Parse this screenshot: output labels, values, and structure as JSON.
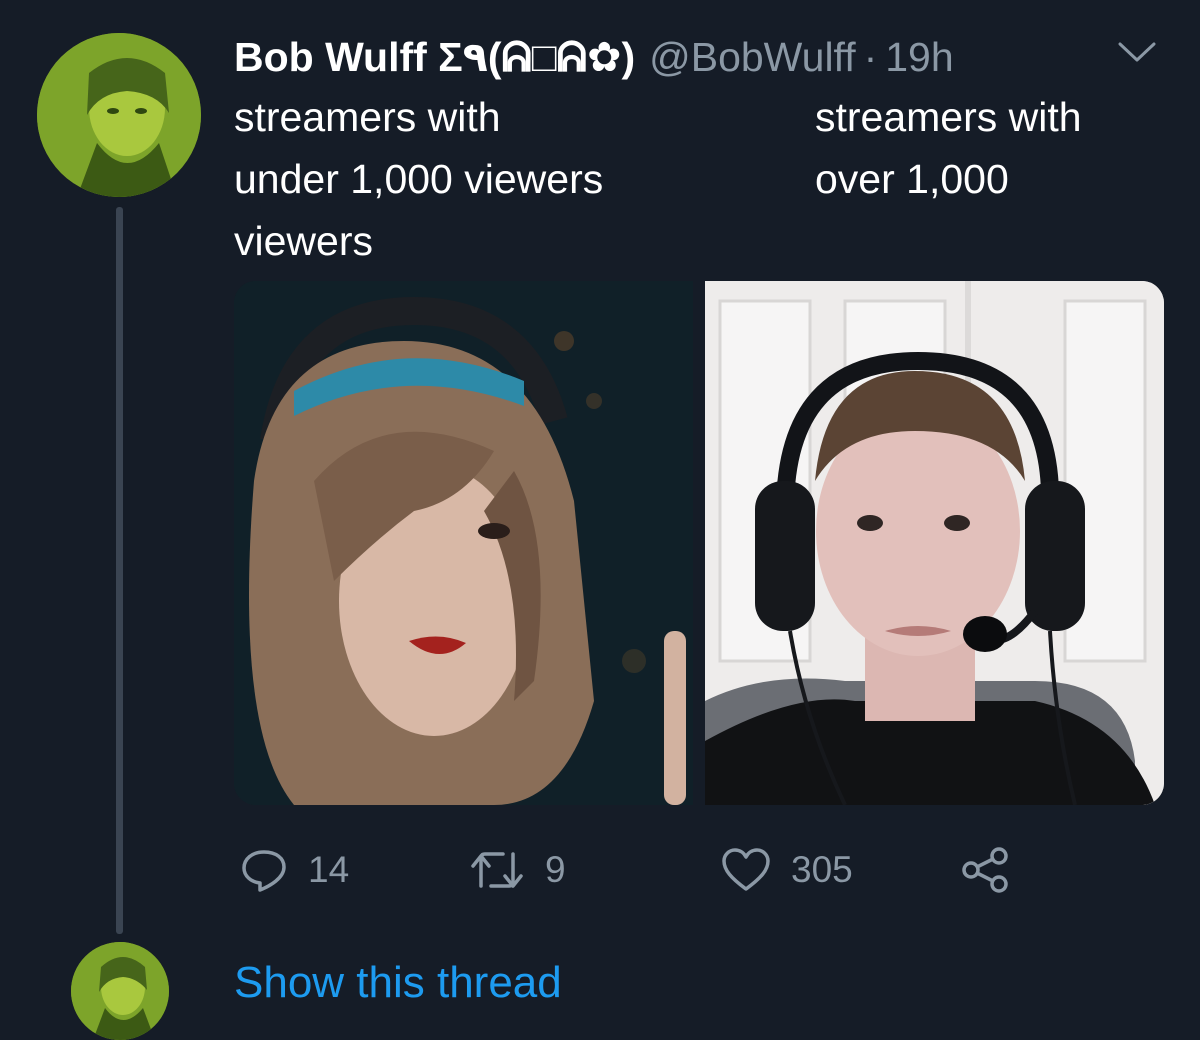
{
  "tweet": {
    "author": {
      "display_name": "Bob Wulff Σ٩(๑•̀ㅂ•́)و✧",
      "display_name_shown": "Bob Wulff Σ٩(ᕱ□ᕱ✿)",
      "handle": "@BobWulff",
      "separator": "·",
      "time": "19h"
    },
    "caption_left": "streamers with\nunder 1,000 viewers\nviewers",
    "caption_right": "streamers with\nover 1,000",
    "media": {
      "left_image": "streamer-with-wig-headset-photo",
      "right_image": "streamer-with-headset-photo"
    },
    "actions": {
      "replies": "14",
      "retweets": "9",
      "likes": "305"
    },
    "show_thread_label": "Show this thread"
  },
  "icons": {
    "reply": "reply-icon",
    "retweet": "retweet-icon",
    "like": "heart-icon",
    "share": "share-icon",
    "menu": "chevron-down-icon"
  },
  "colors": {
    "background": "#151c27",
    "text": "#ffffff",
    "muted": "#8b98a5",
    "link": "#1d9bf0",
    "thread_line": "#3a4452"
  }
}
